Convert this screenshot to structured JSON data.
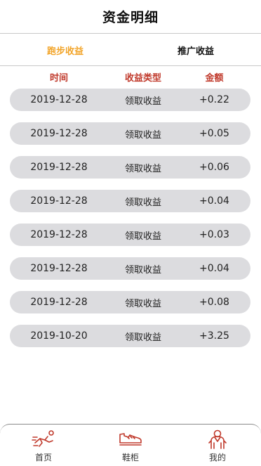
{
  "header": {
    "title": "资金明细"
  },
  "tabs": [
    {
      "label": "跑步收益",
      "active": true
    },
    {
      "label": "推广收益",
      "active": false
    }
  ],
  "columns": {
    "time": "时间",
    "type": "收益类型",
    "amount": "金额"
  },
  "rows": [
    {
      "date": "2019-12-28",
      "type": "领取收益",
      "amount": "+0.22"
    },
    {
      "date": "2019-12-28",
      "type": "领取收益",
      "amount": "+0.05"
    },
    {
      "date": "2019-12-28",
      "type": "领取收益",
      "amount": "+0.06"
    },
    {
      "date": "2019-12-28",
      "type": "领取收益",
      "amount": "+0.04"
    },
    {
      "date": "2019-12-28",
      "type": "领取收益",
      "amount": "+0.03"
    },
    {
      "date": "2019-12-28",
      "type": "领取收益",
      "amount": "+0.04"
    },
    {
      "date": "2019-12-28",
      "type": "领取收益",
      "amount": "+0.08"
    },
    {
      "date": "2019-10-20",
      "type": "领取收益",
      "amount": "+3.25"
    }
  ],
  "tabbar": {
    "items": [
      {
        "label": "首页",
        "icon": "runner-icon"
      },
      {
        "label": "鞋柜",
        "icon": "shoe-icon"
      },
      {
        "label": "我的",
        "icon": "person-icon"
      }
    ]
  },
  "colors": {
    "accent": "#f2a52b",
    "header_red": "#c0392b",
    "icon_red": "#c0392b",
    "row_bg": "#dcdcdf"
  }
}
